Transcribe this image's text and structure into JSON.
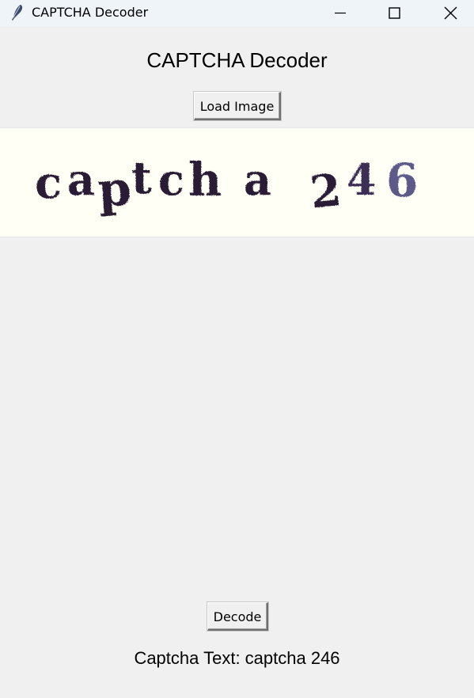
{
  "window": {
    "title": "CAPTCHA Decoder",
    "controls": {
      "minimize": "minimize-icon",
      "maximize": "maximize-icon",
      "close": "close-icon"
    },
    "app_icon": "feather-icon"
  },
  "main": {
    "heading": "CAPTCHA Decoder",
    "load_button_label": "Load Image",
    "captcha_image": {
      "text": "captcha 246"
    },
    "decode_button_label": "Decode",
    "result_text": "Captcha Text: captcha 246"
  },
  "colors": {
    "background": "#f0f0f0",
    "titlebar": "#eff4f9",
    "captcha_background": "#fffff5",
    "captcha_ink": "#2a1a35",
    "captcha_ink_faded": "#5d5a8a"
  }
}
